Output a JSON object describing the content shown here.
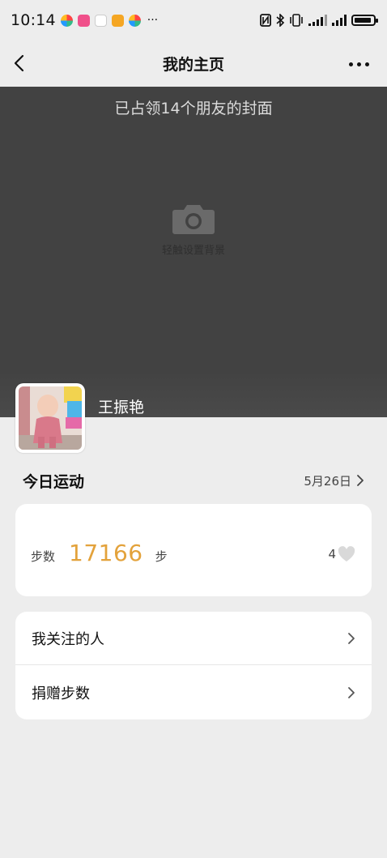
{
  "status_bar": {
    "time": "10:14",
    "more_indicator": "···",
    "app_icons": [
      "pinwheel-app-icon",
      "pink-app-icon",
      "doctor-app-icon",
      "orange-app-icon",
      "pinwheel-app-icon"
    ],
    "system_icons": [
      "nfc-icon",
      "bluetooth-icon",
      "vibrate-icon",
      "signal-icon",
      "signal-icon",
      "battery-icon"
    ]
  },
  "nav": {
    "title": "我的主页",
    "back_icon": "chevron-left-icon",
    "more_icon": "more-dots-icon"
  },
  "cover": {
    "title": "已占领14个朋友的封面",
    "camera_hint": "轻触设置背景",
    "camera_icon": "camera-icon"
  },
  "profile": {
    "name": "王振艳"
  },
  "today": {
    "title": "今日运动",
    "date": "5月26日"
  },
  "steps": {
    "label": "步数",
    "value": "17166",
    "unit": "步",
    "likes": "4",
    "accent": "#e3a23b"
  },
  "menu": {
    "items": [
      {
        "label": "我关注的人"
      },
      {
        "label": "捐赠步数"
      }
    ]
  }
}
